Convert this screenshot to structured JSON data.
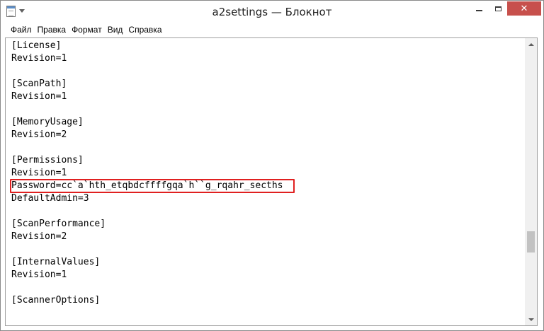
{
  "window": {
    "title": "a2settings — Блокнот"
  },
  "menu": {
    "items": [
      {
        "label": "Файл"
      },
      {
        "label": "Правка"
      },
      {
        "label": "Формат"
      },
      {
        "label": "Вид"
      },
      {
        "label": "Справка"
      }
    ]
  },
  "editor": {
    "lines": [
      "[License]",
      "Revision=1",
      "",
      "[ScanPath]",
      "Revision=1",
      "",
      "[MemoryUsage]",
      "Revision=2",
      "",
      "[Permissions]",
      "Revision=1",
      "Password=cc`a`hth_etqbdcffffgqa`h``g_rqahr_secths",
      "DefaultAdmin=3",
      "",
      "[ScanPerformance]",
      "Revision=2",
      "",
      "[InternalValues]",
      "Revision=1",
      "",
      "[ScannerOptions]"
    ],
    "highlight_color": "#e02020"
  },
  "colors": {
    "close_button": "#c7504c",
    "scroll_thumb": "#c2c2c2"
  },
  "icons": {
    "app": "notepad-icon",
    "quick_access": "chevron-down-icon",
    "minimize": "minimize-icon",
    "maximize": "maximize-icon",
    "close": "close-icon",
    "scroll_up": "arrow-up-icon",
    "scroll_down": "arrow-down-icon"
  }
}
